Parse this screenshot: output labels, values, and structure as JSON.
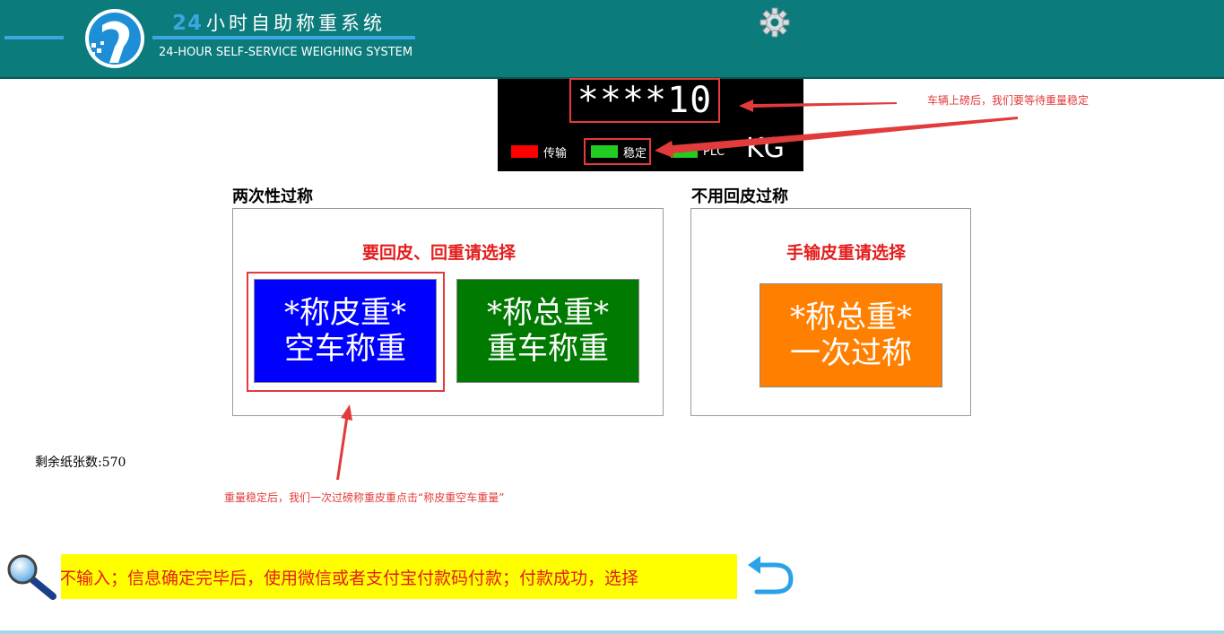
{
  "header": {
    "title_num": "24",
    "title_cn": "小时自助称重系统",
    "title_en": "24-HOUR SELF-SERVICE WEIGHING SYSTEM",
    "settings_icon": "gear-icon",
    "logo_icon": "logo-icon"
  },
  "display": {
    "weight": "****10",
    "unit": "KG",
    "indicators": [
      {
        "label": "传输",
        "color": "#ff0000"
      },
      {
        "label": "稳定",
        "color": "#22cc22"
      },
      {
        "label": "PLC",
        "color": "#22cc22"
      }
    ]
  },
  "two_pass": {
    "title": "两次性过称",
    "prompt": "要回皮、回重请选择",
    "tare_button": {
      "line1": "*称皮重*",
      "line2": "空车称重",
      "color": "#0000ff"
    },
    "gross_button": {
      "line1": "*称总重*",
      "line2": "重车称重",
      "color": "#007a00"
    }
  },
  "no_tare": {
    "title": "不用回皮过称",
    "prompt": "手输皮重请选择",
    "gross_button": {
      "line1": "*称总重*",
      "line2": "一次过称",
      "color": "#ff8000"
    }
  },
  "paper": {
    "label": "剩余纸张数:",
    "count": "570"
  },
  "annotations": {
    "top": "车辆上磅后，我们要等待重量稳定",
    "bottom": "重量稳定后，我们一次过磅称重皮重点击“称皮重空车重量”"
  },
  "bottom": {
    "marquee": "不输入；信息确定完毕后，使用微信或者支付宝付款码付款；付款成功，选择",
    "search_icon": "magnifier-icon",
    "back_icon": "undo-arrow-icon"
  },
  "colors": {
    "header": "#0c7b7b",
    "accent": "#3ba6e0",
    "annotation": "#e23b3b"
  }
}
